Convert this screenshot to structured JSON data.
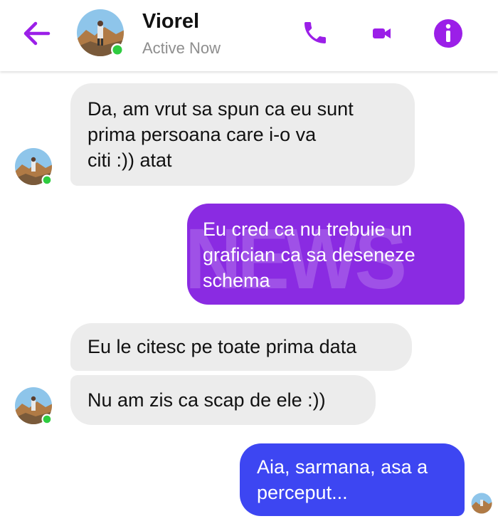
{
  "header": {
    "contact_name": "Viorel",
    "status": "Active Now",
    "accent_color": "#9b1fe8"
  },
  "watermark": "NEWS",
  "messages": [
    {
      "sender": "contact",
      "text": "Da, am vrut sa spun ca eu sunt\nprima persoana care i-o va\nciti :)) atat"
    },
    {
      "sender": "me",
      "text": "Eu cred ca nu trebuie un\ngrafician ca sa deseneze\nschema"
    },
    {
      "sender": "contact",
      "text": "Eu le citesc pe toate prima data"
    },
    {
      "sender": "contact",
      "text": "Nu am zis ca scap de ele :))"
    },
    {
      "sender": "me",
      "text": "Aia, sarmana, asa a\nperceput..."
    }
  ],
  "colors": {
    "incoming_bubble": "#ececec",
    "outgoing_bubble_purple": "#8a2be2",
    "outgoing_bubble_blue": "#3d46f2",
    "online_dot": "#2ecc40"
  },
  "icons": [
    "back-arrow-icon",
    "phone-icon",
    "video-camera-icon",
    "info-icon"
  ]
}
